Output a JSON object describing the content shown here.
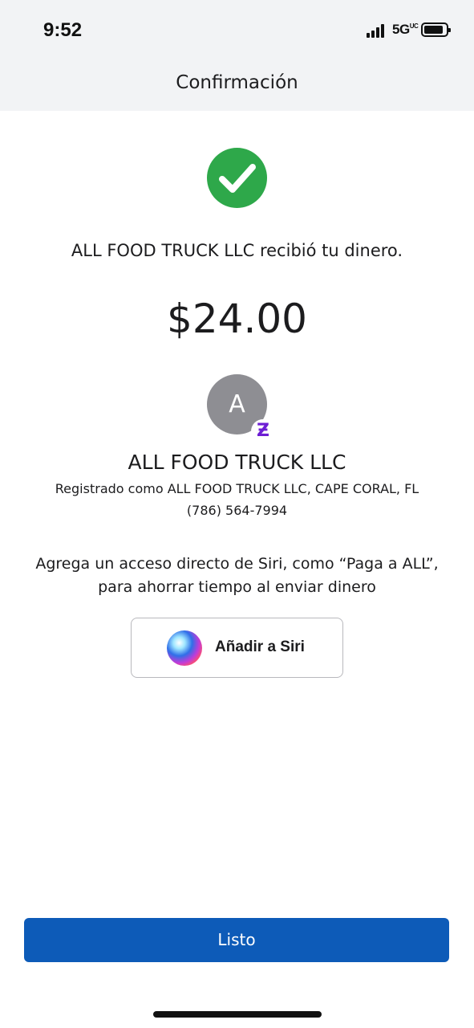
{
  "status_bar": {
    "time": "9:52",
    "network": "5G",
    "network_suffix": "UC"
  },
  "nav": {
    "title": "Confirmación"
  },
  "confirmation": {
    "message": "ALL FOOD TRUCK LLC recibió tu dinero.",
    "amount": "$24.00",
    "success_color": "#2ea84a"
  },
  "recipient": {
    "avatar_initial": "A",
    "badge_symbol": "Ƶ",
    "name": "ALL FOOD TRUCK LLC",
    "registered": "Registrado como ALL FOOD TRUCK LLC, CAPE CORAL, FL",
    "phone": "(786) 564-7994"
  },
  "siri": {
    "prompt": "Agrega un acceso directo de Siri, como “Paga a ALL”, para ahorrar tiempo al enviar dinero",
    "button_label": "Añadir a Siri"
  },
  "footer": {
    "done_label": "Listo",
    "button_color": "#0d5bb8"
  }
}
